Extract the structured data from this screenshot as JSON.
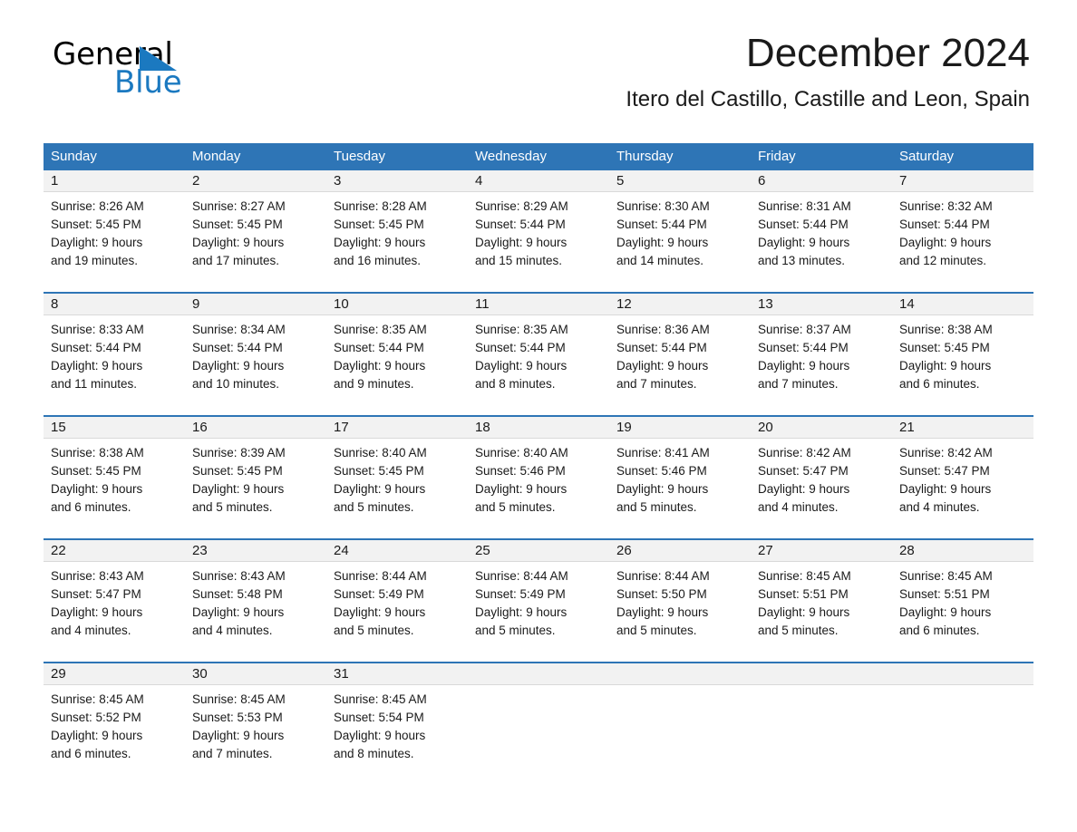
{
  "logo": {
    "word_dark": "General",
    "word_blue": "Blue",
    "triangle_color": "#1b79c0"
  },
  "header": {
    "title": "December 2024",
    "subtitle": "Itero del Castillo, Castille and Leon, Spain"
  },
  "colors": {
    "header_blue": "#2e75b6",
    "day_band_gray": "#f2f2f2",
    "text": "#1a1a1a"
  },
  "weekdays": [
    "Sunday",
    "Monday",
    "Tuesday",
    "Wednesday",
    "Thursday",
    "Friday",
    "Saturday"
  ],
  "weeks": [
    [
      {
        "day": "1",
        "sunrise": "Sunrise: 8:26 AM",
        "sunset": "Sunset: 5:45 PM",
        "daylight_1": "Daylight: 9 hours",
        "daylight_2": "and 19 minutes."
      },
      {
        "day": "2",
        "sunrise": "Sunrise: 8:27 AM",
        "sunset": "Sunset: 5:45 PM",
        "daylight_1": "Daylight: 9 hours",
        "daylight_2": "and 17 minutes."
      },
      {
        "day": "3",
        "sunrise": "Sunrise: 8:28 AM",
        "sunset": "Sunset: 5:45 PM",
        "daylight_1": "Daylight: 9 hours",
        "daylight_2": "and 16 minutes."
      },
      {
        "day": "4",
        "sunrise": "Sunrise: 8:29 AM",
        "sunset": "Sunset: 5:44 PM",
        "daylight_1": "Daylight: 9 hours",
        "daylight_2": "and 15 minutes."
      },
      {
        "day": "5",
        "sunrise": "Sunrise: 8:30 AM",
        "sunset": "Sunset: 5:44 PM",
        "daylight_1": "Daylight: 9 hours",
        "daylight_2": "and 14 minutes."
      },
      {
        "day": "6",
        "sunrise": "Sunrise: 8:31 AM",
        "sunset": "Sunset: 5:44 PM",
        "daylight_1": "Daylight: 9 hours",
        "daylight_2": "and 13 minutes."
      },
      {
        "day": "7",
        "sunrise": "Sunrise: 8:32 AM",
        "sunset": "Sunset: 5:44 PM",
        "daylight_1": "Daylight: 9 hours",
        "daylight_2": "and 12 minutes."
      }
    ],
    [
      {
        "day": "8",
        "sunrise": "Sunrise: 8:33 AM",
        "sunset": "Sunset: 5:44 PM",
        "daylight_1": "Daylight: 9 hours",
        "daylight_2": "and 11 minutes."
      },
      {
        "day": "9",
        "sunrise": "Sunrise: 8:34 AM",
        "sunset": "Sunset: 5:44 PM",
        "daylight_1": "Daylight: 9 hours",
        "daylight_2": "and 10 minutes."
      },
      {
        "day": "10",
        "sunrise": "Sunrise: 8:35 AM",
        "sunset": "Sunset: 5:44 PM",
        "daylight_1": "Daylight: 9 hours",
        "daylight_2": "and 9 minutes."
      },
      {
        "day": "11",
        "sunrise": "Sunrise: 8:35 AM",
        "sunset": "Sunset: 5:44 PM",
        "daylight_1": "Daylight: 9 hours",
        "daylight_2": "and 8 minutes."
      },
      {
        "day": "12",
        "sunrise": "Sunrise: 8:36 AM",
        "sunset": "Sunset: 5:44 PM",
        "daylight_1": "Daylight: 9 hours",
        "daylight_2": "and 7 minutes."
      },
      {
        "day": "13",
        "sunrise": "Sunrise: 8:37 AM",
        "sunset": "Sunset: 5:44 PM",
        "daylight_1": "Daylight: 9 hours",
        "daylight_2": "and 7 minutes."
      },
      {
        "day": "14",
        "sunrise": "Sunrise: 8:38 AM",
        "sunset": "Sunset: 5:45 PM",
        "daylight_1": "Daylight: 9 hours",
        "daylight_2": "and 6 minutes."
      }
    ],
    [
      {
        "day": "15",
        "sunrise": "Sunrise: 8:38 AM",
        "sunset": "Sunset: 5:45 PM",
        "daylight_1": "Daylight: 9 hours",
        "daylight_2": "and 6 minutes."
      },
      {
        "day": "16",
        "sunrise": "Sunrise: 8:39 AM",
        "sunset": "Sunset: 5:45 PM",
        "daylight_1": "Daylight: 9 hours",
        "daylight_2": "and 5 minutes."
      },
      {
        "day": "17",
        "sunrise": "Sunrise: 8:40 AM",
        "sunset": "Sunset: 5:45 PM",
        "daylight_1": "Daylight: 9 hours",
        "daylight_2": "and 5 minutes."
      },
      {
        "day": "18",
        "sunrise": "Sunrise: 8:40 AM",
        "sunset": "Sunset: 5:46 PM",
        "daylight_1": "Daylight: 9 hours",
        "daylight_2": "and 5 minutes."
      },
      {
        "day": "19",
        "sunrise": "Sunrise: 8:41 AM",
        "sunset": "Sunset: 5:46 PM",
        "daylight_1": "Daylight: 9 hours",
        "daylight_2": "and 5 minutes."
      },
      {
        "day": "20",
        "sunrise": "Sunrise: 8:42 AM",
        "sunset": "Sunset: 5:47 PM",
        "daylight_1": "Daylight: 9 hours",
        "daylight_2": "and 4 minutes."
      },
      {
        "day": "21",
        "sunrise": "Sunrise: 8:42 AM",
        "sunset": "Sunset: 5:47 PM",
        "daylight_1": "Daylight: 9 hours",
        "daylight_2": "and 4 minutes."
      }
    ],
    [
      {
        "day": "22",
        "sunrise": "Sunrise: 8:43 AM",
        "sunset": "Sunset: 5:47 PM",
        "daylight_1": "Daylight: 9 hours",
        "daylight_2": "and 4 minutes."
      },
      {
        "day": "23",
        "sunrise": "Sunrise: 8:43 AM",
        "sunset": "Sunset: 5:48 PM",
        "daylight_1": "Daylight: 9 hours",
        "daylight_2": "and 4 minutes."
      },
      {
        "day": "24",
        "sunrise": "Sunrise: 8:44 AM",
        "sunset": "Sunset: 5:49 PM",
        "daylight_1": "Daylight: 9 hours",
        "daylight_2": "and 5 minutes."
      },
      {
        "day": "25",
        "sunrise": "Sunrise: 8:44 AM",
        "sunset": "Sunset: 5:49 PM",
        "daylight_1": "Daylight: 9 hours",
        "daylight_2": "and 5 minutes."
      },
      {
        "day": "26",
        "sunrise": "Sunrise: 8:44 AM",
        "sunset": "Sunset: 5:50 PM",
        "daylight_1": "Daylight: 9 hours",
        "daylight_2": "and 5 minutes."
      },
      {
        "day": "27",
        "sunrise": "Sunrise: 8:45 AM",
        "sunset": "Sunset: 5:51 PM",
        "daylight_1": "Daylight: 9 hours",
        "daylight_2": "and 5 minutes."
      },
      {
        "day": "28",
        "sunrise": "Sunrise: 8:45 AM",
        "sunset": "Sunset: 5:51 PM",
        "daylight_1": "Daylight: 9 hours",
        "daylight_2": "and 6 minutes."
      }
    ],
    [
      {
        "day": "29",
        "sunrise": "Sunrise: 8:45 AM",
        "sunset": "Sunset: 5:52 PM",
        "daylight_1": "Daylight: 9 hours",
        "daylight_2": "and 6 minutes."
      },
      {
        "day": "30",
        "sunrise": "Sunrise: 8:45 AM",
        "sunset": "Sunset: 5:53 PM",
        "daylight_1": "Daylight: 9 hours",
        "daylight_2": "and 7 minutes."
      },
      {
        "day": "31",
        "sunrise": "Sunrise: 8:45 AM",
        "sunset": "Sunset: 5:54 PM",
        "daylight_1": "Daylight: 9 hours",
        "daylight_2": "and 8 minutes."
      },
      {
        "day": "",
        "sunrise": "",
        "sunset": "",
        "daylight_1": "",
        "daylight_2": ""
      },
      {
        "day": "",
        "sunrise": "",
        "sunset": "",
        "daylight_1": "",
        "daylight_2": ""
      },
      {
        "day": "",
        "sunrise": "",
        "sunset": "",
        "daylight_1": "",
        "daylight_2": ""
      },
      {
        "day": "",
        "sunrise": "",
        "sunset": "",
        "daylight_1": "",
        "daylight_2": ""
      }
    ]
  ]
}
